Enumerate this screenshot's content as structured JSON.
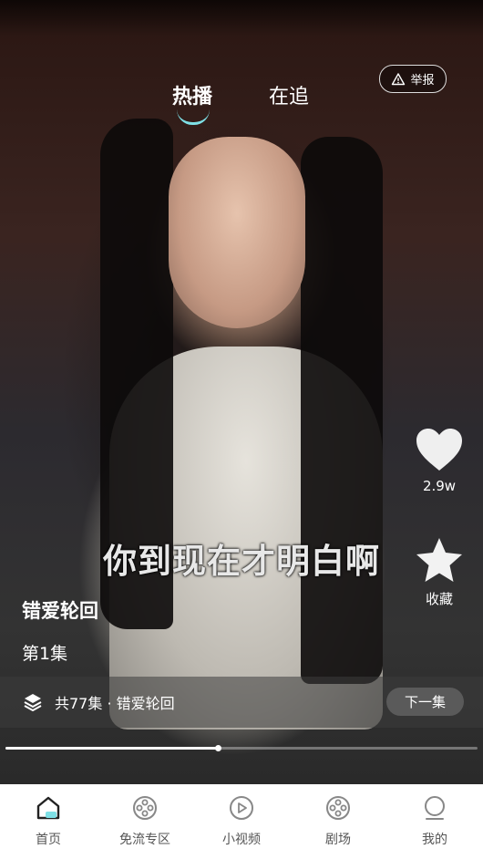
{
  "tabs": {
    "hot": "热播",
    "following": "在追"
  },
  "report": {
    "label": "举报"
  },
  "side_actions": {
    "likes": "2.9w",
    "favorite": "收藏"
  },
  "subtitle": "你到现在才明白啊",
  "drama": {
    "title": "错爱轮回",
    "episode": "第1集"
  },
  "series": {
    "summary": "共77集 · 错爱轮回",
    "next_label": "下一集"
  },
  "playback": {
    "progress": 0.45
  },
  "nav": {
    "items": [
      {
        "label": "首页",
        "icon": "home-icon"
      },
      {
        "label": "免流专区",
        "icon": "film-reel-icon"
      },
      {
        "label": "小视频",
        "icon": "play-circle-icon"
      },
      {
        "label": "剧场",
        "icon": "film-reel-icon"
      },
      {
        "label": "我的",
        "icon": "profile-icon"
      }
    ]
  },
  "colors": {
    "accent": "#7ee0e6",
    "nav_bg": "#ffffff"
  }
}
